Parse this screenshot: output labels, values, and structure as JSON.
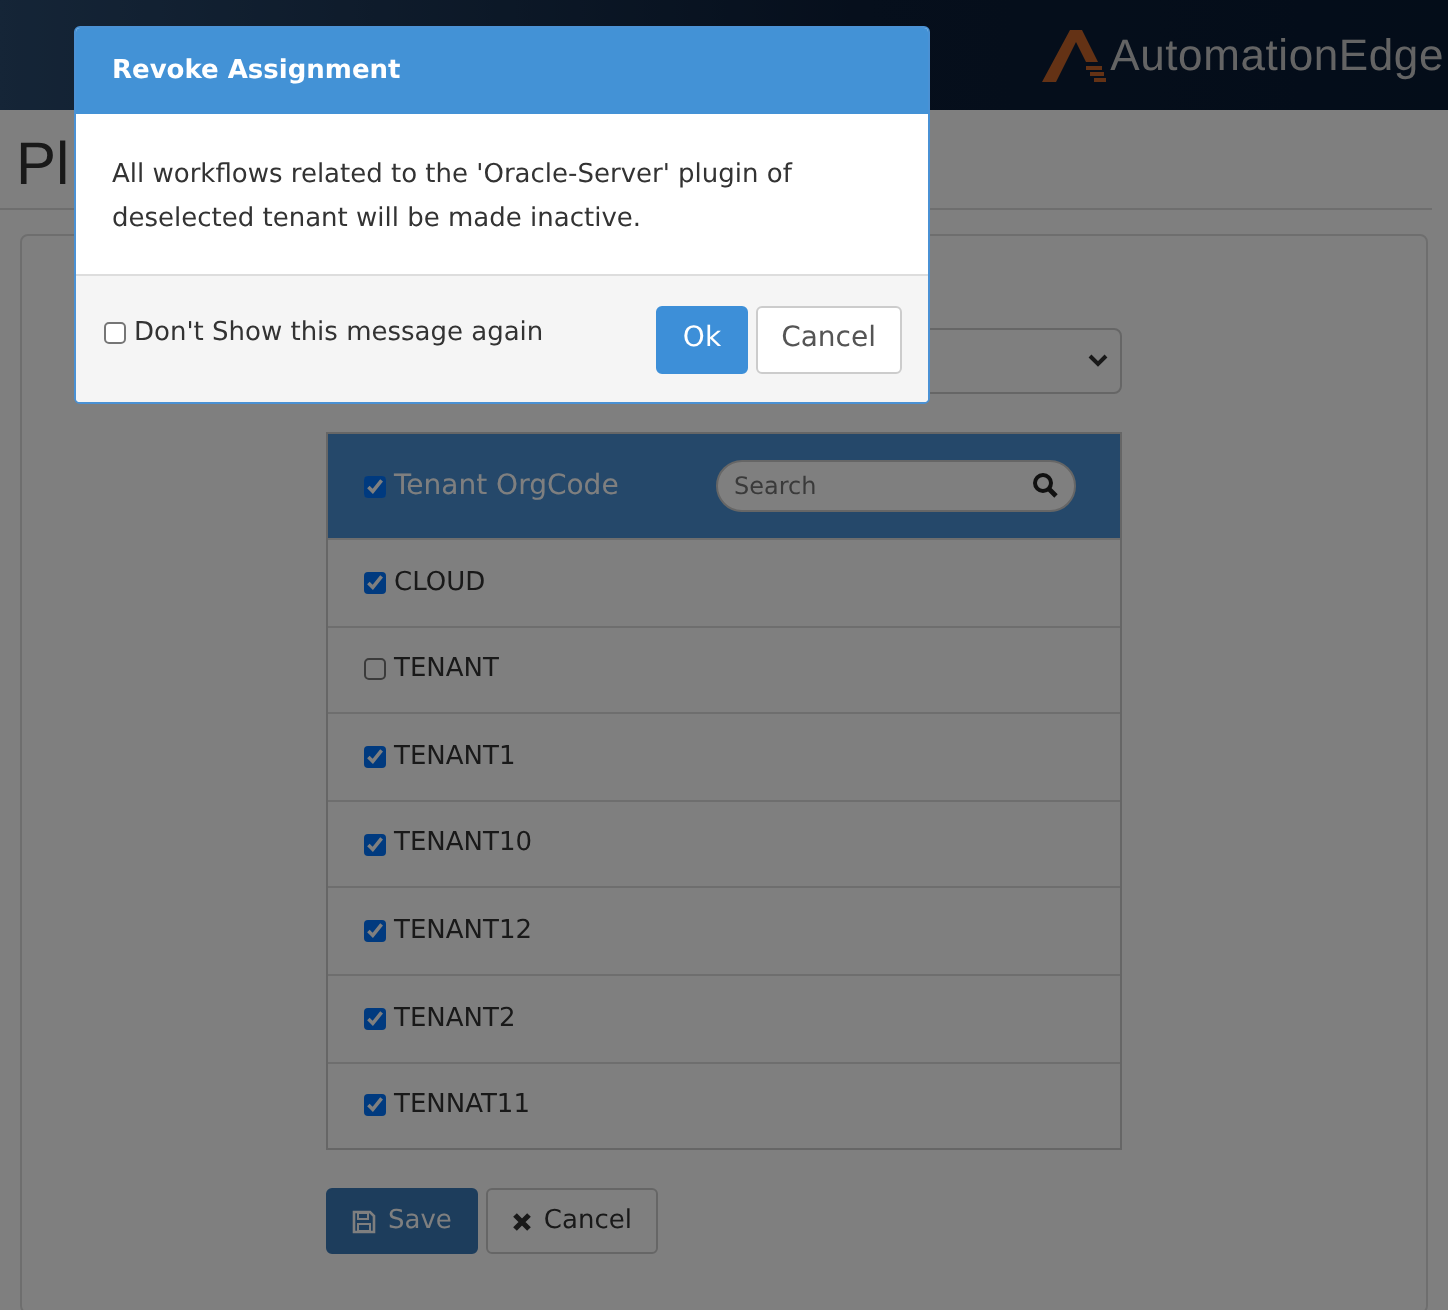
{
  "header": {
    "brand": "AutomationEdge"
  },
  "page": {
    "title": "Pl"
  },
  "tenant_table": {
    "header": {
      "label": "Tenant OrgCode",
      "checked": true,
      "search_placeholder": "Search"
    },
    "rows": [
      {
        "label": "CLOUD",
        "checked": true
      },
      {
        "label": "TENANT",
        "checked": false
      },
      {
        "label": "TENANT1",
        "checked": true
      },
      {
        "label": "TENANT10",
        "checked": true
      },
      {
        "label": "TENANT12",
        "checked": true
      },
      {
        "label": "TENANT2",
        "checked": true
      },
      {
        "label": "TENNAT11",
        "checked": true
      }
    ]
  },
  "form_buttons": [
    {
      "label": "Save",
      "kind": "primary"
    },
    {
      "label": "Cancel",
      "kind": "secondary"
    }
  ],
  "modal": {
    "title": "Revoke Assignment",
    "message": "All workflows related to the 'Oracle-Server' plugin of deselected tenant will be made inactive.",
    "dont_show": {
      "label": "Don't Show this message again",
      "checked": false
    },
    "buttons": [
      {
        "label": "Ok",
        "kind": "primary"
      },
      {
        "label": "Cancel",
        "kind": "secondary"
      }
    ]
  }
}
